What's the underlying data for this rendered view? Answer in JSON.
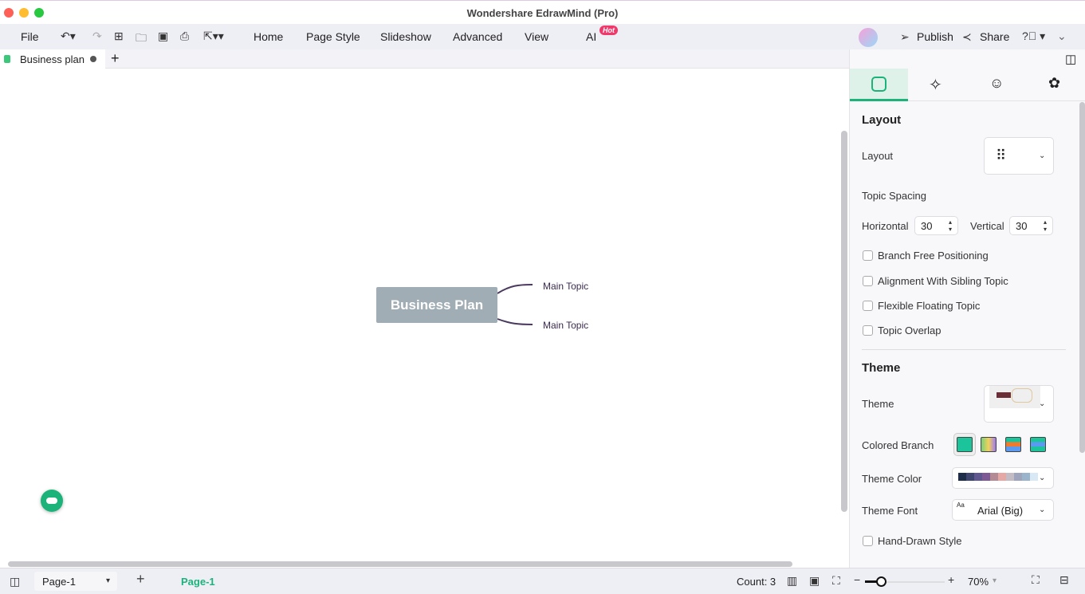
{
  "window": {
    "title": "Wondershare EdrawMind (Pro)"
  },
  "menu": {
    "file": "File",
    "home": "Home",
    "page_style": "Page Style",
    "slideshow": "Slideshow",
    "advanced": "Advanced",
    "view": "View",
    "ai": "AI",
    "ai_badge": "Hot",
    "publish": "Publish",
    "share": "Share"
  },
  "tabs": [
    {
      "label": "Business plan"
    }
  ],
  "mindmap": {
    "central": "Business Plan",
    "topics": [
      "Main Topic",
      "Main Topic"
    ]
  },
  "panel": {
    "layout_heading": "Layout",
    "layout_label": "Layout",
    "topic_spacing": "Topic Spacing",
    "horizontal_label": "Horizontal",
    "horizontal_value": "30",
    "vertical_label": "Vertical",
    "vertical_value": "30",
    "checkboxes": [
      {
        "label": "Branch Free Positioning",
        "checked": false
      },
      {
        "label": "Alignment With Sibling Topic",
        "checked": false
      },
      {
        "label": "Flexible Floating Topic",
        "checked": false
      },
      {
        "label": "Topic Overlap",
        "checked": false
      }
    ],
    "theme_heading": "Theme",
    "theme_label": "Theme",
    "colored_branch_label": "Colored Branch",
    "theme_color_label": "Theme Color",
    "theme_colors": [
      "#1e2e4a",
      "#3e4670",
      "#5e5790",
      "#7d5a94",
      "#b48a94",
      "#e6a8a4",
      "#c4bcc4",
      "#9ea4bc",
      "#9ab4cc",
      "#d8e8f4"
    ],
    "theme_font_label": "Theme Font",
    "theme_font_value": "Arial (Big)",
    "hand_drawn_label": "Hand-Drawn Style"
  },
  "status": {
    "page_select": "Page-1",
    "page_tab": "Page-1",
    "count": "Count: 3",
    "zoom": "70%",
    "zoom_fraction": 0.2
  },
  "colors": {
    "accent": "#1bb37a",
    "central_node": "#a0adb4",
    "branch": "#4a3a5e"
  }
}
